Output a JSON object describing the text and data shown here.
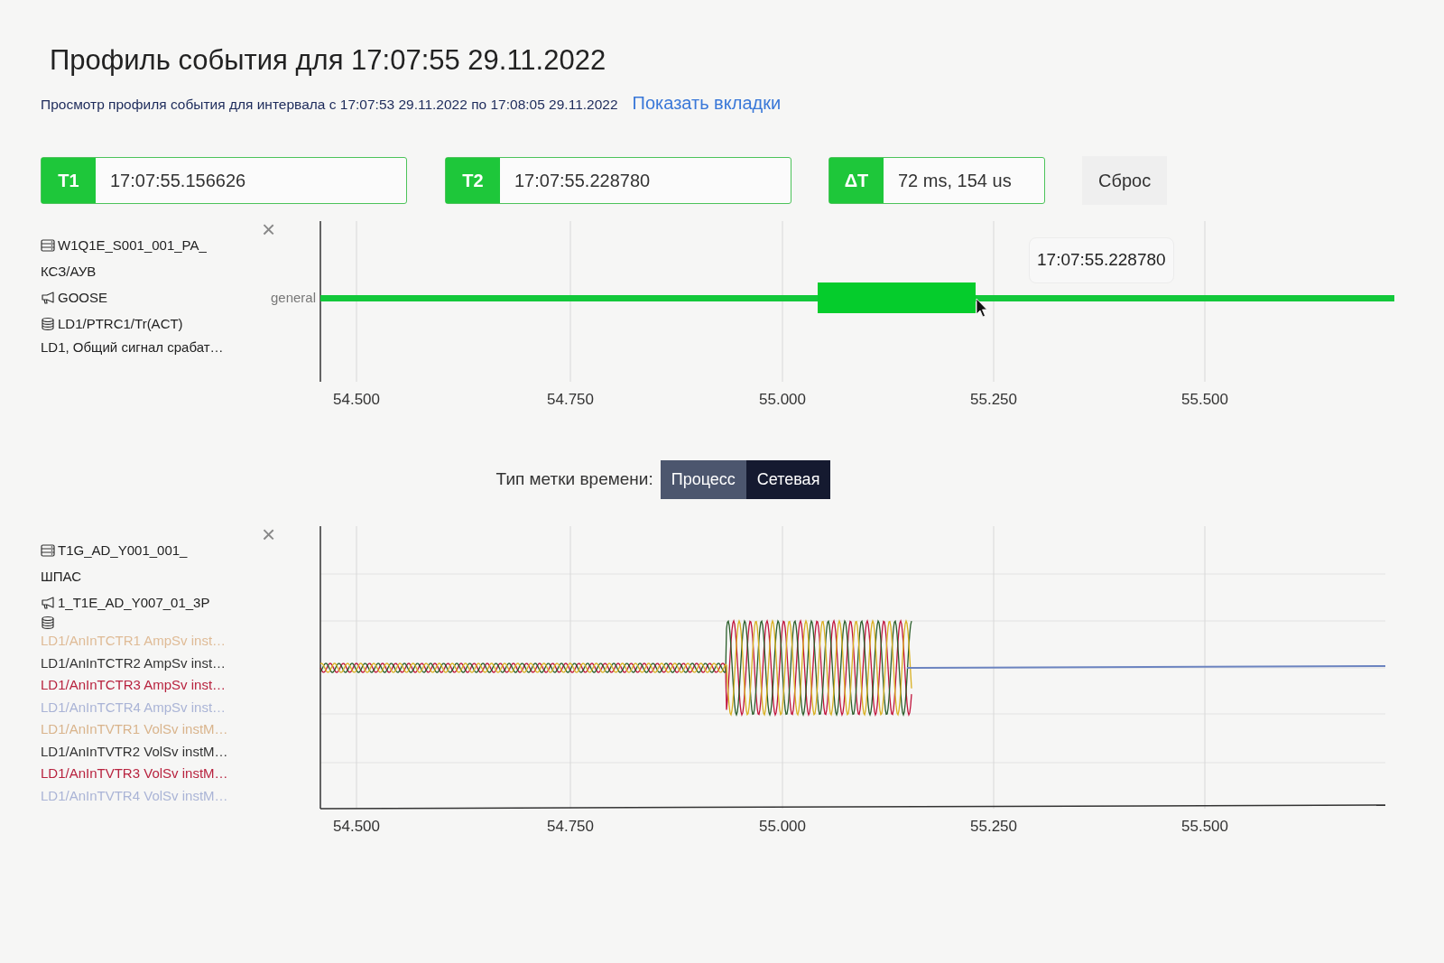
{
  "title": "Профиль события для 17:07:55 29.11.2022",
  "subtitle": "Просмотр профиля события для интервала с 17:07:53 29.11.2022 по 17:08:05 29.11.2022",
  "show_tabs_link": "Показать вкладки",
  "markers": [
    {
      "label": "T1",
      "value": "17:07:55.156626"
    },
    {
      "label": "T2",
      "value": "17:07:55.228780"
    },
    {
      "label": "ΔT",
      "value": "72 ms, 154 us"
    }
  ],
  "reset_button": "Сброс",
  "chart_panels": [
    {
      "kind": "state",
      "device_lines": [
        "W1Q1E_S001_001_PA_",
        "КСЗ/АУВ"
      ],
      "stream": "GOOSE",
      "dataset": "LD1/PTRC1/Tr(ACT)",
      "close": "×",
      "signals": [
        {
          "text": "LD1, Общий сигнал срабат…"
        }
      ],
      "track_label": "general",
      "tooltip": "17:07:55.228780",
      "x_ticks": [
        "54.500",
        "54.750",
        "55.000",
        "55.250",
        "55.500"
      ]
    },
    {
      "kind": "waveform",
      "device_lines": [
        "T1G_AD_Y001_001_",
        "ШПАС"
      ],
      "stream": "1_T1E_AD_Y007_01_3P",
      "close": "×",
      "signals": [
        {
          "text": "LD1/AnInTCTR1 AmpSv inst…",
          "color": "#dfbb96"
        },
        {
          "text": "LD1/AnInTCTR2 AmpSv inst…",
          "color": "#333333"
        },
        {
          "text": "LD1/AnInTCTR3 AmpSv inst…",
          "color": "#b8233f"
        },
        {
          "text": "LD1/AnInTCTR4 AmpSv inst…",
          "color": "#aab4d6"
        },
        {
          "text": "LD1/AnInTVTR1 VolSv instM…",
          "color": "#d9b48c"
        },
        {
          "text": "LD1/AnInTVTR2 VolSv instM…",
          "color": "#333333"
        },
        {
          "text": "LD1/AnInTVTR3 VolSv instM…",
          "color": "#b8233f"
        },
        {
          "text": "LD1/AnInTVTR4 VolSv instM…",
          "color": "#aab4d6"
        }
      ],
      "x_ticks": [
        "54.500",
        "54.750",
        "55.000",
        "55.250",
        "55.500"
      ]
    }
  ],
  "timestamp_type": {
    "label": "Тип метки времени:",
    "options": [
      {
        "label": "Процесс",
        "selected": false
      },
      {
        "label": "Сетевая",
        "selected": true
      }
    ]
  }
}
